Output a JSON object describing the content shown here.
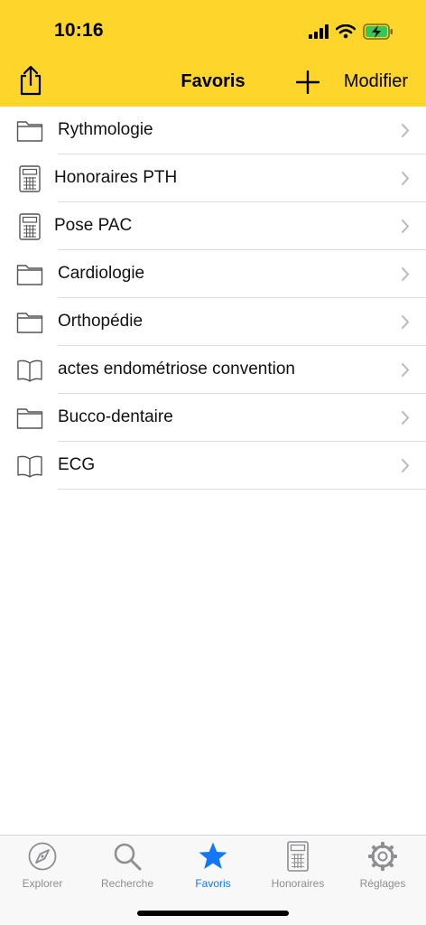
{
  "status_bar": {
    "time": "10:16"
  },
  "nav": {
    "title": "Favoris",
    "edit_label": "Modifier"
  },
  "favorites": [
    {
      "label": "Rythmologie",
      "icon": "folder-icon"
    },
    {
      "label": "Honoraires PTH",
      "icon": "calculator-icon"
    },
    {
      "label": "Pose PAC",
      "icon": "calculator-icon"
    },
    {
      "label": "Cardiologie",
      "icon": "folder-icon"
    },
    {
      "label": "Orthopédie",
      "icon": "folder-icon"
    },
    {
      "label": "actes endométriose convention",
      "icon": "book-icon"
    },
    {
      "label": "Bucco-dentaire",
      "icon": "folder-icon"
    },
    {
      "label": "ECG",
      "icon": "book-icon"
    }
  ],
  "tabs": [
    {
      "label": "Explorer",
      "icon": "compass-icon",
      "active": false
    },
    {
      "label": "Recherche",
      "icon": "magnifier-icon",
      "active": false
    },
    {
      "label": "Favoris",
      "icon": "star-icon",
      "active": true
    },
    {
      "label": "Honoraires",
      "icon": "calculator-icon",
      "active": false
    },
    {
      "label": "Réglages",
      "icon": "gear-icon",
      "active": false
    }
  ],
  "colors": {
    "header": "#fdd52b",
    "active_tab": "#1477f8",
    "inactive_tab": "#8e8e93",
    "battery_charge": "#34c759"
  }
}
